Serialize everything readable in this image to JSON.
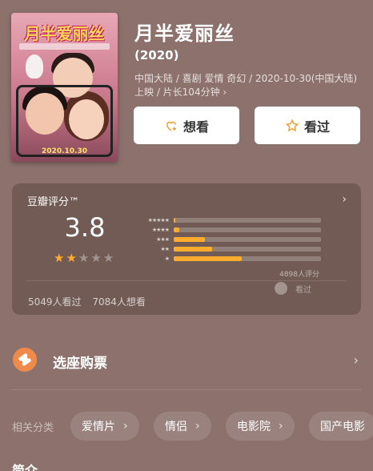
{
  "movie": {
    "title": "月半爱丽丝",
    "year": "(2020)",
    "meta": "中国大陆 / 喜剧 爱情 奇幻 / 2020-10-30(中国大陆) 上映 / 片长104分钟 ›",
    "poster": {
      "title": "月半爱丽丝",
      "date": "2020.10.30"
    }
  },
  "actions": {
    "want_label": "想看",
    "seen_label": "看过",
    "want_icon": "heart-plus-icon",
    "seen_icon": "star-outline-icon"
  },
  "rating": {
    "label": "豆瓣评分™",
    "score": "3.8",
    "stars_filled": 2,
    "stars_total": 5,
    "distribution": [
      {
        "stars": "★★★★★",
        "percent": 1
      },
      {
        "stars": "★★★★",
        "percent": 4
      },
      {
        "stars": "★★★",
        "percent": 21
      },
      {
        "stars": "★★",
        "percent": 26
      },
      {
        "stars": "★",
        "percent": 46
      }
    ],
    "raters": "4898人评分",
    "friend_note": "看过",
    "watched": "5049人看过",
    "wanted": "7084人想看"
  },
  "tickets": {
    "label": "选座购票",
    "icon": "ticket-icon",
    "icon_color": "#f08a4b"
  },
  "categories": {
    "label": "相关分类",
    "items": [
      "爱情片",
      "情侣",
      "电影院",
      "国产电影"
    ]
  },
  "section": {
    "title": "简介"
  },
  "colors": {
    "background": "#8c716c",
    "accent": "#ffac2d"
  }
}
